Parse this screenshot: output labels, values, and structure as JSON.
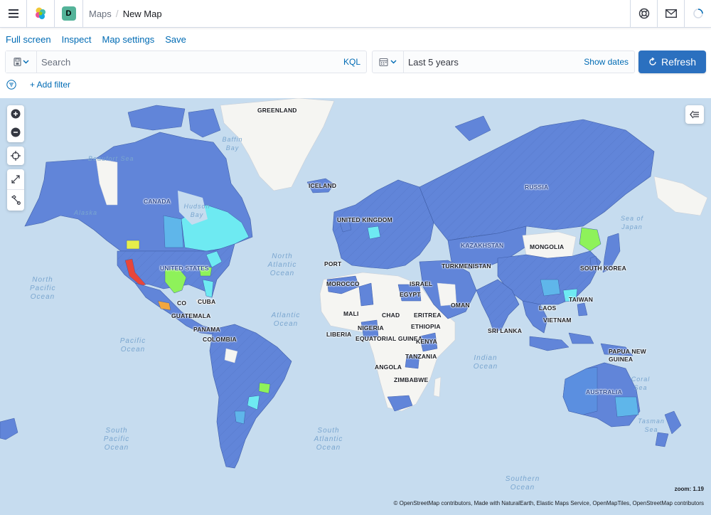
{
  "header": {
    "space_initial": "D",
    "breadcrumbs": {
      "parent": "Maps",
      "separator": "/",
      "current": "New Map"
    },
    "icons": [
      "menu-icon",
      "elastic-logo-icon",
      "help-icon",
      "newsfeed-icon",
      "loading-spinner-icon"
    ]
  },
  "app_menu": {
    "full_screen": "Full screen",
    "inspect": "Inspect",
    "map_settings": "Map settings",
    "save": "Save"
  },
  "query_bar": {
    "search_placeholder": "Search",
    "query_language": "KQL",
    "time_range": "Last 5 years",
    "show_dates": "Show dates",
    "refresh": "Refresh"
  },
  "filter_bar": {
    "add_filter": "+ Add filter"
  },
  "map": {
    "zoom_label": "zoom: 1.19",
    "attribution": "© OpenStreetMap contributors, Made with NaturalEarth, Elastic Maps Service, OpenMapTiles, OpenStreetMap contributors",
    "labels": {
      "greenland": "GREENLAND",
      "iceland": "ICELAND",
      "canada": "CANADA",
      "united_states": "UNITED STATES",
      "russia": "RUSSIA",
      "mongolia": "MONGOLIA",
      "kazakhstan": "KAZAKHSTAN",
      "turkmenistan": "TURKMENISTAN",
      "south_korea": "SOUTH KOREA",
      "taiwan": "TAIWAN",
      "laos": "LAOS",
      "vietnam": "VIETNAM",
      "sri_lanka": "SRI LANKA",
      "oman": "OMAN",
      "israel": "ISRAEL",
      "egypt": "EGYPT",
      "morocco": "MOROCCO",
      "mali": "MALI",
      "chad": "CHAD",
      "eritrea": "ERITREA",
      "ethiopia": "ETHIOPIA",
      "nigeria": "NIGERIA",
      "liberia": "LIBERIA",
      "equatorial_guinea": "EQUATORIAL GUINEA",
      "kenya": "KENYA",
      "tanzania": "TANZANIA",
      "angola": "ANGOLA",
      "zimbabwe": "ZIMBABWE",
      "united_kingdom": "UNITED KINGDOM",
      "portugal": "PORT",
      "cuba": "CUBA",
      "mexico": "CO",
      "guatemala": "GUATEMALA",
      "panama": "PANAMA",
      "colombia": "COLOMBIA",
      "australia": "AUSTRALIA",
      "papua_new_guinea": "PAPUA NEW GUINEA",
      "north_pacific": "North Pacific Ocean",
      "pacific": "Pacific Ocean",
      "north_atlantic": "North Atlantic Ocean",
      "atlantic": "Atlantic Ocean",
      "indian": "Indian Ocean",
      "south_pacific": "South Pacific Ocean",
      "south_atlantic": "South Atlantic Ocean",
      "southern": "Southern Ocean",
      "baffin_bay": "Baffin Bay",
      "hudson_bay": "Hudson Bay",
      "beaufort_sea": "Beaufort Sea",
      "alaska": "Alaska",
      "coral_sea": "Coral Sea",
      "tasman_sea": "Tasman Sea",
      "sea_of_japan": "Sea of Japan"
    },
    "colors": {
      "ocean": "#c6dcef",
      "land_nodata": "#f5f5f2",
      "choropleth_low": "#6185d9",
      "choropleth_mid": "#5fb6ea",
      "choropleth_cyan": "#6eeaf2",
      "choropleth_green": "#8ef25a",
      "choropleth_yellow": "#e6ee4a",
      "choropleth_red": "#e8463a"
    }
  }
}
